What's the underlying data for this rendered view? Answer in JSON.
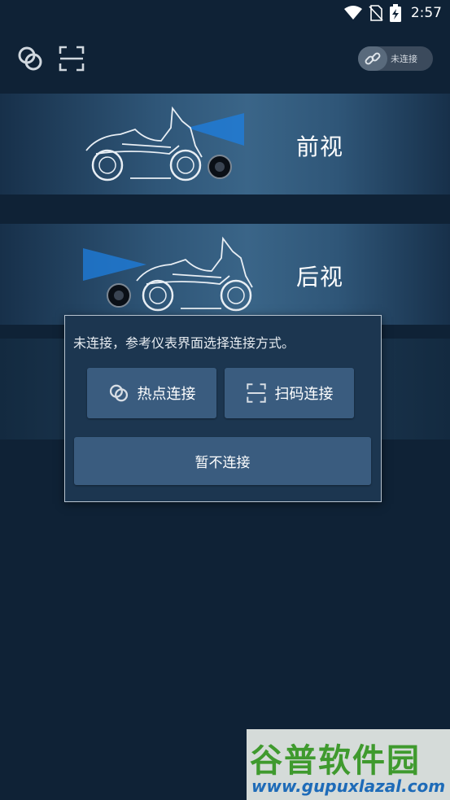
{
  "status_bar": {
    "time": "2:57"
  },
  "top_bar": {
    "connection_status": "未连接"
  },
  "cards": {
    "front": {
      "label": "前视"
    },
    "rear": {
      "label": "后视"
    }
  },
  "dialog": {
    "message": "未连接，参考仪表界面选择连接方式。",
    "hotspot_label": "热点连接",
    "scan_label": "扫码连接",
    "skip_label": "暂不连接"
  },
  "watermark": {
    "title": "谷普软件园",
    "url": "www.gupuxlazal.com"
  },
  "colors": {
    "background": "#0f2236",
    "card_highlight": "#3a6588",
    "button": "#3a5c7f",
    "beam": "#1e7fe0"
  },
  "icons": [
    "wifi-icon",
    "no-sim-icon",
    "battery-charging-icon",
    "hotspot-link-icon",
    "scan-icon",
    "chain-link-icon",
    "motorcycle-icon",
    "camera-icon"
  ]
}
